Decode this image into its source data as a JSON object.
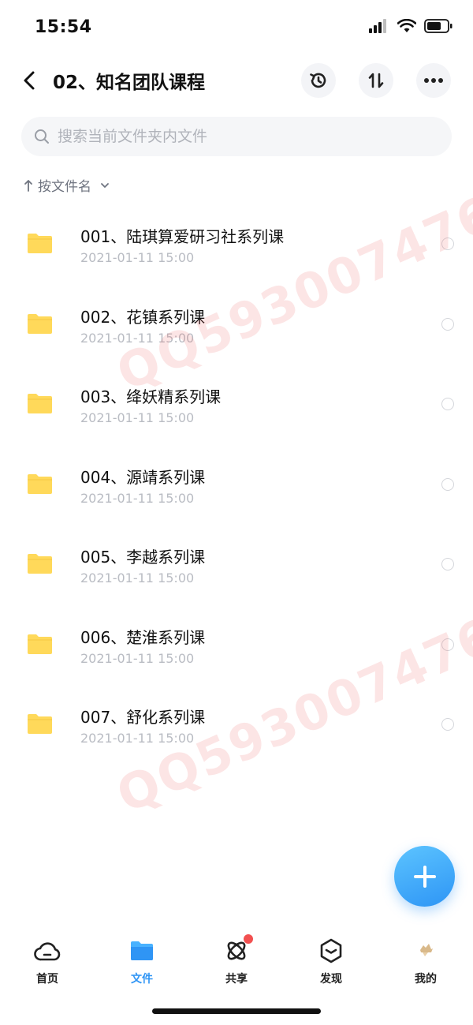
{
  "status": {
    "time": "15:54"
  },
  "header": {
    "title": "02、知名团队课程"
  },
  "search": {
    "placeholder": "搜索当前文件夹内文件"
  },
  "sort": {
    "label": "按文件名"
  },
  "files": [
    {
      "name": "001、陆琪算爱研习社系列课",
      "date": "2021-01-11 15:00"
    },
    {
      "name": "002、花镇系列课",
      "date": "2021-01-11 15:00"
    },
    {
      "name": "003、绛妖精系列课",
      "date": "2021-01-11 15:00"
    },
    {
      "name": "004、源靖系列课",
      "date": "2021-01-11 15:00"
    },
    {
      "name": "005、李越系列课",
      "date": "2021-01-11 15:00"
    },
    {
      "name": "006、楚淮系列课",
      "date": "2021-01-11 15:00"
    },
    {
      "name": "007、舒化系列课",
      "date": "2021-01-11 15:00"
    }
  ],
  "watermark": "QQ593007476",
  "tabs": [
    {
      "label": "首页",
      "icon": "cloud-icon"
    },
    {
      "label": "文件",
      "icon": "folder-icon",
      "active": true
    },
    {
      "label": "共享",
      "icon": "orbit-icon",
      "badge": true
    },
    {
      "label": "发现",
      "icon": "cube-icon"
    },
    {
      "label": "我的",
      "icon": "avatar-icon"
    }
  ],
  "colors": {
    "accent": "#2f95f5",
    "folder": "#ffd95a",
    "badge": "#f25050",
    "watermark": "#f06e6e"
  }
}
